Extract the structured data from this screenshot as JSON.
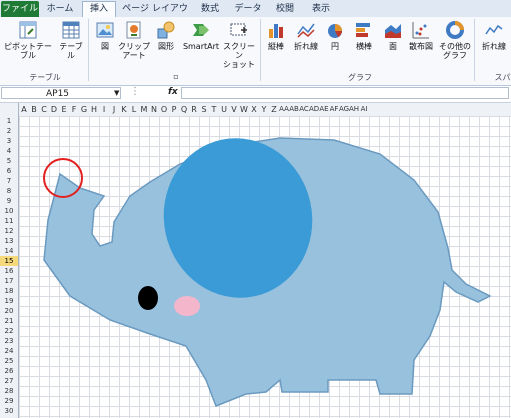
{
  "tabs": [
    "ファイル",
    "ホーム",
    "挿入",
    "ページ レイアウト",
    "数式",
    "データ",
    "校閲",
    "表示"
  ],
  "ribbon": {
    "pivot_table": "ピボットテーブル",
    "table": "テーブル",
    "group_table": "テーブル",
    "picture": "図",
    "clipart_1": "クリップ",
    "clipart_2": "アート",
    "shapes": "図形",
    "smartart": "SmartArt",
    "screenshot_1": "スクリーン",
    "screenshot_2": "ショット",
    "column": "縦棒",
    "line": "折れ線",
    "pie": "円",
    "bar": "横棒",
    "area": "面",
    "scatter": "散布図",
    "other_1": "その他の",
    "other_2": "グラフ",
    "group_chart": "グラフ",
    "sparkline_line": "折れ線",
    "group_sparkline": "スパ"
  },
  "formula": {
    "name_box": "AP15",
    "fx": "fx"
  },
  "columns": [
    "A",
    "B",
    "C",
    "D",
    "E",
    "F",
    "G",
    "H",
    "I",
    "J",
    "K",
    "L",
    "M",
    "N",
    "O",
    "P",
    "Q",
    "R",
    "S",
    "T",
    "U",
    "V",
    "W",
    "X",
    "Y",
    "Z",
    "AA",
    "AB",
    "AC",
    "AD",
    "AE",
    "AF",
    "AG",
    "AH",
    "AI"
  ],
  "rows": [
    "1",
    "2",
    "3",
    "4",
    "5",
    "6",
    "7",
    "8",
    "9",
    "10",
    "11",
    "12",
    "13",
    "14",
    "15",
    "16",
    "17",
    "18",
    "19",
    "20",
    "21",
    "22",
    "23",
    "24",
    "25",
    "26",
    "27",
    "28",
    "29",
    "30"
  ],
  "selected_row": "15",
  "colors": {
    "elephant_body": "#98c1dd",
    "elephant_ear": "#3a9bd6",
    "cheek": "#f4b6cb",
    "highlight_circle": "#e32020",
    "file_tab": "#1f7a36"
  }
}
